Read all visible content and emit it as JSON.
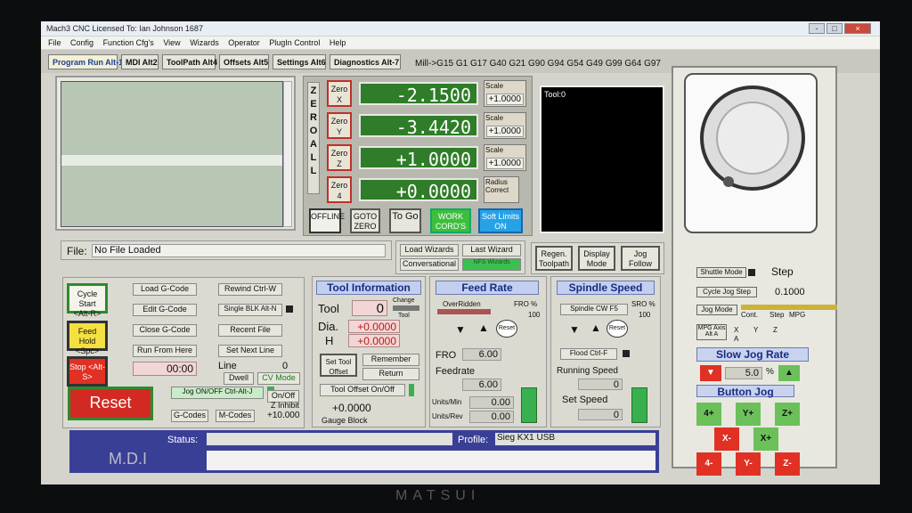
{
  "window": {
    "title": "Mach3 CNC  Licensed To: Ian Johnson 1687",
    "controls": [
      "-",
      "□",
      "×"
    ]
  },
  "menu": [
    "File",
    "Config",
    "Function Cfg's",
    "View",
    "Wizards",
    "Operator",
    "PlugIn Control",
    "Help"
  ],
  "tabs": [
    "Program Run Alt-1",
    "MDI Alt2",
    "ToolPath Alt4",
    "Offsets Alt5",
    "Settings Alt6",
    "Diagnostics Alt-7"
  ],
  "gcode_status": "Mill->G15  G1 G17 G40 G21 G90 G94 G54 G49 G99 G64 G97",
  "dro": {
    "zero_all": "ZERO ALL",
    "axes": [
      {
        "zero": "Zero X",
        "value": "-2.1500",
        "scale_label": "Scale",
        "scale": "+1.0000"
      },
      {
        "zero": "Zero Y",
        "value": "-3.4420",
        "scale_label": "Scale",
        "scale": "+1.0000"
      },
      {
        "zero": "Zero Z",
        "value": "+1.0000",
        "scale_label": "Scale",
        "scale": "+1.0000"
      },
      {
        "zero": "Zero 4",
        "value": "+0.0000",
        "scale_label": "Radius Correct",
        "scale": ""
      }
    ],
    "buttons": {
      "offline": "OFFLINE",
      "goto_zero": "GOTO ZERO",
      "to_go": "To Go",
      "work_coords": "WORK CORD'S",
      "soft_limits": "Soft Limits ON"
    }
  },
  "tool_window": {
    "label": "Tool:0"
  },
  "file": {
    "label": "File:",
    "value": "No File Loaded"
  },
  "wizards": {
    "load": "Load Wizards",
    "last": "Last Wizard",
    "conversational": "Conversational",
    "nfs": "NFS Wizards"
  },
  "view": {
    "regen": "Regen. Toolpath",
    "display": "Display Mode",
    "jog_follow": "Jog Follow"
  },
  "program": {
    "cycle_start": "Cycle Start <Alt-R>",
    "feed_hold": "Feed Hold <Spc>",
    "stop": "Stop <Alt-S>",
    "load_gcode": "Load G-Code",
    "edit_gcode": "Edit G-Code",
    "close_gcode": "Close G-Code",
    "run_from_here": "Run From Here",
    "rewind": "Rewind Ctrl-W",
    "single_blk": "Single BLK Alt-N",
    "recent_file": "Recent File",
    "set_next_line": "Set Next Line",
    "time": "00:00",
    "line_label": "Line",
    "line_value": "0",
    "dwell": "Dwell",
    "cv_mode": "CV Mode",
    "reset": "Reset",
    "jog_toggle": "Jog ON/OFF Ctrl-Alt-J",
    "gcodes": "G-Codes",
    "mcodes": "M-Codes",
    "z_inhibit_onoff": "On/Off",
    "z_inhibit": "Z Inhibit",
    "z_value": "+10.000"
  },
  "tool_info": {
    "title": "Tool Information",
    "tool_label": "Tool",
    "tool": "0",
    "change_label": "Change",
    "tool_label2": "Tool",
    "dia_label": "Dia.",
    "dia": "+0.0000",
    "h_label": "H",
    "h": "+0.0000",
    "set_offset": "Set Tool Offset",
    "remember": "Remember",
    "return": "Return",
    "offset_onoff": "Tool Offset On/Off",
    "gauge": "+0.0000",
    "gauge_label": "Gauge Block"
  },
  "feed": {
    "title": "Feed Rate",
    "overridden": "OverRidden",
    "fro_pct_label": "FRO %",
    "fro_pct": "100",
    "reset": "Reset",
    "fro_label": "FRO",
    "fro": "6.00",
    "feedrate_label": "Feedrate",
    "feedrate": "6.00",
    "units_min_label": "Units/Min",
    "units_min": "0.00",
    "units_rev_label": "Units/Rev",
    "units_rev": "0.00"
  },
  "spindle": {
    "title": "Spindle Speed",
    "cw": "Spindle CW F5",
    "sro_label": "SRO %",
    "sro": "100",
    "reset": "Reset",
    "flood": "Flood Ctrl-F",
    "running_label": "Running Speed",
    "running": "0",
    "set_label": "Set Speed",
    "set": "0"
  },
  "jog": {
    "shuttle": "Shuttle Mode",
    "step": "Step",
    "cycle_step": "Cycle Jog Step",
    "step_value": "0.1000",
    "jog_mode": "Jog Mode",
    "cont": "Cont.",
    "step2": "Step",
    "mpg": "MPG",
    "mpg_axis": "MPG Axis Alt A",
    "x": "X",
    "y": "Y",
    "z": "Z",
    "a": "A",
    "slow_rate_label": "Slow Jog Rate",
    "slow_rate": "5.0",
    "pct": "%",
    "button_jog": "Button Jog",
    "buttons": [
      "4+",
      "Y+",
      "Z+",
      "X-",
      "X+",
      "4-",
      "Y-",
      "Z-"
    ]
  },
  "status": {
    "label": "Status:",
    "value": "",
    "profile_label": "Profile:",
    "profile": "Sieg KX1 USB",
    "mdi": "M.D.I"
  },
  "monitor_brand": "MATSUI",
  "colors": {
    "green_dro": "#2f7d28",
    "red": "#d22a22",
    "blue_head": "#c4cff0"
  }
}
